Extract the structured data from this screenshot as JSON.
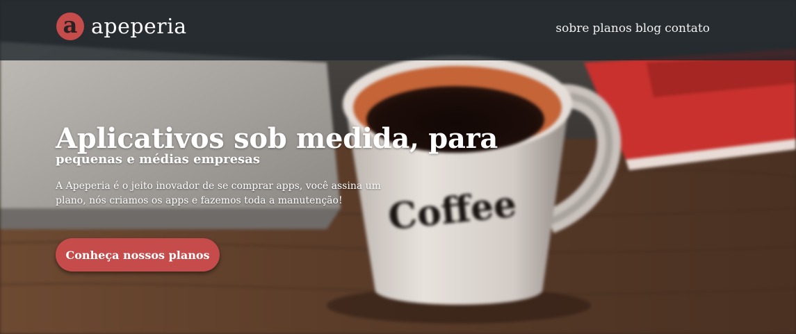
{
  "header": {
    "logo_letter": "a",
    "brand_name": "apeperia",
    "nav": [
      {
        "label": "sobre"
      },
      {
        "label": "planos"
      },
      {
        "label": "blog"
      },
      {
        "label": "contato"
      }
    ]
  },
  "hero": {
    "title": "Aplicativos sob medida, para",
    "subtitle": "pequenas e médias empresas",
    "description": "A Apeperia é o jeito inovador de se comprar apps, você assina um plano, nós criamos os apps e fazemos toda a manutenção!",
    "cta_label": "Conheça nossos planos"
  },
  "background": {
    "mug_text": "Coffee"
  },
  "colors": {
    "accent": "#c64b4b",
    "header_bg": "#1e262a",
    "text": "#ffffff"
  }
}
